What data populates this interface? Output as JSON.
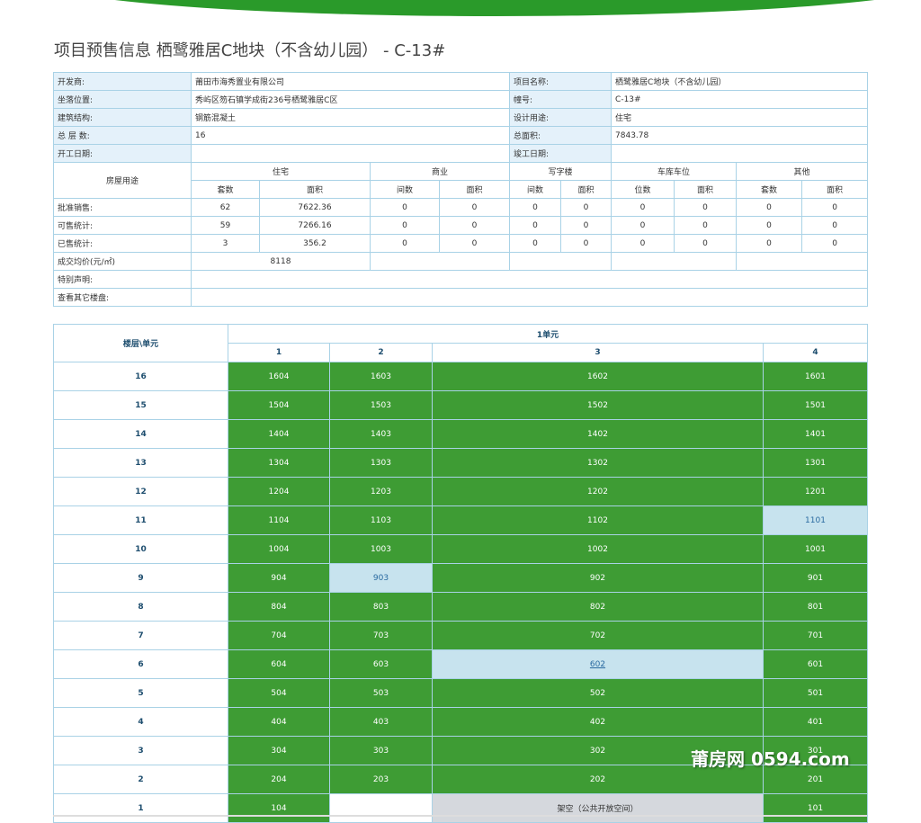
{
  "title": "项目预售信息 栖鹭雅居C地块（不含幼儿园） - C-13#",
  "info": {
    "developer_label": "开发商:",
    "developer": "莆田市海秀置业有限公司",
    "project_label": "项目名称:",
    "project": "栖鹭雅居C地块（不含幼儿园）",
    "location_label": "坐落位置:",
    "location": "秀屿区笏石镇学成街236号栖鹭雅居C区",
    "building_label": "幢号:",
    "building": "C-13#",
    "structure_label": "建筑结构:",
    "structure": "钢筋混凝土",
    "usage_label": "设计用途:",
    "usage": "住宅",
    "floors_label": "总 层 数:",
    "floors": "16",
    "area_label": "总面积:",
    "area": "7843.78",
    "start_label": "开工日期:",
    "start": "",
    "finish_label": "竣工日期:",
    "finish": ""
  },
  "stats": {
    "row_header": "房屋用途",
    "categories": [
      "住宅",
      "商业",
      "写字楼",
      "车库车位",
      "其他"
    ],
    "sub": [
      [
        "套数",
        "面积"
      ],
      [
        "间数",
        "面积"
      ],
      [
        "间数",
        "面积"
      ],
      [
        "位数",
        "面积"
      ],
      [
        "套数",
        "面积"
      ]
    ],
    "rows": [
      {
        "label": "批准销售:",
        "values": [
          "62",
          "7622.36",
          "0",
          "0",
          "0",
          "0",
          "0",
          "0",
          "0",
          "0"
        ]
      },
      {
        "label": "可售统计:",
        "values": [
          "59",
          "7266.16",
          "0",
          "0",
          "0",
          "0",
          "0",
          "0",
          "0",
          "0"
        ]
      },
      {
        "label": "已售统计:",
        "values": [
          "3",
          "356.2",
          "0",
          "0",
          "0",
          "0",
          "0",
          "0",
          "0",
          "0"
        ]
      }
    ],
    "avg_label": "成交均价(元/㎡)",
    "avg": "8118",
    "note_label": "特别声明:",
    "other_label": "查看其它楼盘:"
  },
  "grid": {
    "corner": "楼层\\单元",
    "unit": "1单元",
    "cols": [
      "1",
      "2",
      "3",
      "4"
    ],
    "rows": [
      {
        "floor": "16",
        "cells": [
          {
            "t": "1604",
            "s": "g"
          },
          {
            "t": "1603",
            "s": "g"
          },
          {
            "t": "1602",
            "s": "g"
          },
          {
            "t": "1601",
            "s": "g"
          }
        ]
      },
      {
        "floor": "15",
        "cells": [
          {
            "t": "1504",
            "s": "g"
          },
          {
            "t": "1503",
            "s": "g"
          },
          {
            "t": "1502",
            "s": "g"
          },
          {
            "t": "1501",
            "s": "g"
          }
        ]
      },
      {
        "floor": "14",
        "cells": [
          {
            "t": "1404",
            "s": "g"
          },
          {
            "t": "1403",
            "s": "g"
          },
          {
            "t": "1402",
            "s": "g"
          },
          {
            "t": "1401",
            "s": "g"
          }
        ]
      },
      {
        "floor": "13",
        "cells": [
          {
            "t": "1304",
            "s": "g"
          },
          {
            "t": "1303",
            "s": "g"
          },
          {
            "t": "1302",
            "s": "g"
          },
          {
            "t": "1301",
            "s": "g"
          }
        ]
      },
      {
        "floor": "12",
        "cells": [
          {
            "t": "1204",
            "s": "g"
          },
          {
            "t": "1203",
            "s": "g"
          },
          {
            "t": "1202",
            "s": "g"
          },
          {
            "t": "1201",
            "s": "g"
          }
        ]
      },
      {
        "floor": "11",
        "cells": [
          {
            "t": "1104",
            "s": "g"
          },
          {
            "t": "1103",
            "s": "g"
          },
          {
            "t": "1102",
            "s": "g"
          },
          {
            "t": "1101",
            "s": "b"
          }
        ]
      },
      {
        "floor": "10",
        "cells": [
          {
            "t": "1004",
            "s": "g"
          },
          {
            "t": "1003",
            "s": "g"
          },
          {
            "t": "1002",
            "s": "g"
          },
          {
            "t": "1001",
            "s": "g"
          }
        ]
      },
      {
        "floor": "9",
        "cells": [
          {
            "t": "904",
            "s": "g"
          },
          {
            "t": "903",
            "s": "b"
          },
          {
            "t": "902",
            "s": "g"
          },
          {
            "t": "901",
            "s": "g"
          }
        ]
      },
      {
        "floor": "8",
        "cells": [
          {
            "t": "804",
            "s": "g"
          },
          {
            "t": "803",
            "s": "g"
          },
          {
            "t": "802",
            "s": "g"
          },
          {
            "t": "801",
            "s": "g"
          }
        ]
      },
      {
        "floor": "7",
        "cells": [
          {
            "t": "704",
            "s": "g"
          },
          {
            "t": "703",
            "s": "g"
          },
          {
            "t": "702",
            "s": "g"
          },
          {
            "t": "701",
            "s": "g"
          }
        ]
      },
      {
        "floor": "6",
        "cells": [
          {
            "t": "604",
            "s": "g"
          },
          {
            "t": "603",
            "s": "g"
          },
          {
            "t": "602",
            "s": "b u"
          },
          {
            "t": "601",
            "s": "g"
          }
        ]
      },
      {
        "floor": "5",
        "cells": [
          {
            "t": "504",
            "s": "g"
          },
          {
            "t": "503",
            "s": "g"
          },
          {
            "t": "502",
            "s": "g"
          },
          {
            "t": "501",
            "s": "g"
          }
        ]
      },
      {
        "floor": "4",
        "cells": [
          {
            "t": "404",
            "s": "g"
          },
          {
            "t": "403",
            "s": "g"
          },
          {
            "t": "402",
            "s": "g"
          },
          {
            "t": "401",
            "s": "g"
          }
        ]
      },
      {
        "floor": "3",
        "cells": [
          {
            "t": "304",
            "s": "g"
          },
          {
            "t": "303",
            "s": "g"
          },
          {
            "t": "302",
            "s": "g"
          },
          {
            "t": "301",
            "s": "g"
          }
        ]
      },
      {
        "floor": "2",
        "cells": [
          {
            "t": "204",
            "s": "g"
          },
          {
            "t": "203",
            "s": "g"
          },
          {
            "t": "202",
            "s": "g"
          },
          {
            "t": "201",
            "s": "g"
          }
        ]
      },
      {
        "floor": "1",
        "cells": [
          {
            "t": "104",
            "s": "g"
          },
          {
            "t": "",
            "s": "w"
          },
          {
            "t": "架空（公共开放空间）",
            "s": "gray"
          },
          {
            "t": "101",
            "s": "g"
          }
        ]
      }
    ]
  },
  "watermark": "莆房网 0594.com",
  "colors": {
    "sold_green": "#3e9c34",
    "available_blue": "#c7e3ee",
    "label_bg": "#e4f1fa",
    "border": "#a9d2e6"
  }
}
